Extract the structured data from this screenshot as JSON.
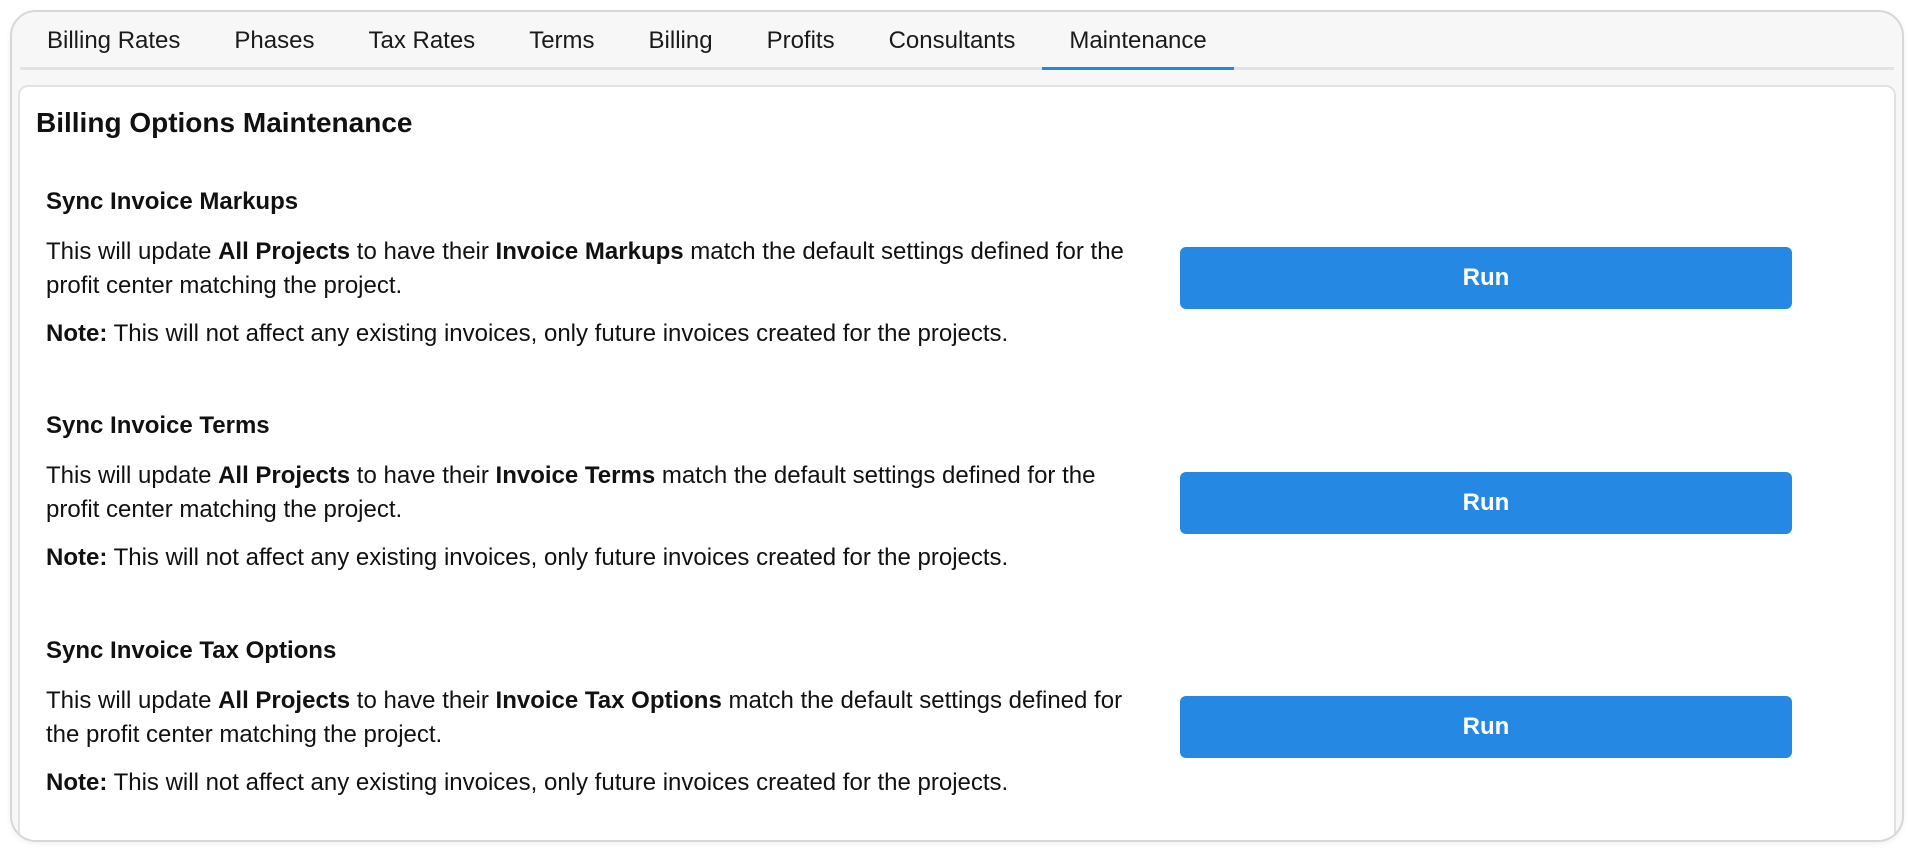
{
  "tabs": [
    {
      "label": "Billing Rates"
    },
    {
      "label": "Phases"
    },
    {
      "label": "Tax Rates"
    },
    {
      "label": "Terms"
    },
    {
      "label": "Billing"
    },
    {
      "label": "Profits"
    },
    {
      "label": "Consultants"
    },
    {
      "label": "Maintenance"
    }
  ],
  "active_tab": "Maintenance",
  "panel": {
    "title": "Billing Options Maintenance"
  },
  "sections": [
    {
      "title": "Sync Invoice Markups",
      "desc_pre": "This will update ",
      "desc_bold1": "All Projects",
      "desc_mid": " to have their ",
      "desc_bold2": "Invoice Markups",
      "desc_post": " match the default settings defined for the profit center matching the project.",
      "note_label": "Note:",
      "note_text": " This will not affect any existing invoices, only future invoices created for the projects.",
      "button_label": "Run"
    },
    {
      "title": "Sync Invoice Terms",
      "desc_pre": "This will update ",
      "desc_bold1": "All Projects",
      "desc_mid": " to have their ",
      "desc_bold2": "Invoice Terms",
      "desc_post": " match the default settings defined for the profit center matching the project.",
      "note_label": "Note:",
      "note_text": " This will not affect any existing invoices, only future invoices created for the projects.",
      "button_label": "Run"
    },
    {
      "title": "Sync Invoice Tax Options",
      "desc_pre": "This will update ",
      "desc_bold1": "All Projects",
      "desc_mid": " to have their ",
      "desc_bold2": "Invoice Tax Options",
      "desc_post": " match the default settings defined for the profit center matching the project.",
      "note_label": "Note:",
      "note_text": " This will not affect any existing invoices, only future invoices created for the projects.",
      "button_label": "Run"
    }
  ],
  "colors": {
    "accent": "#2589e4",
    "tab_underline": "#2587e3"
  }
}
